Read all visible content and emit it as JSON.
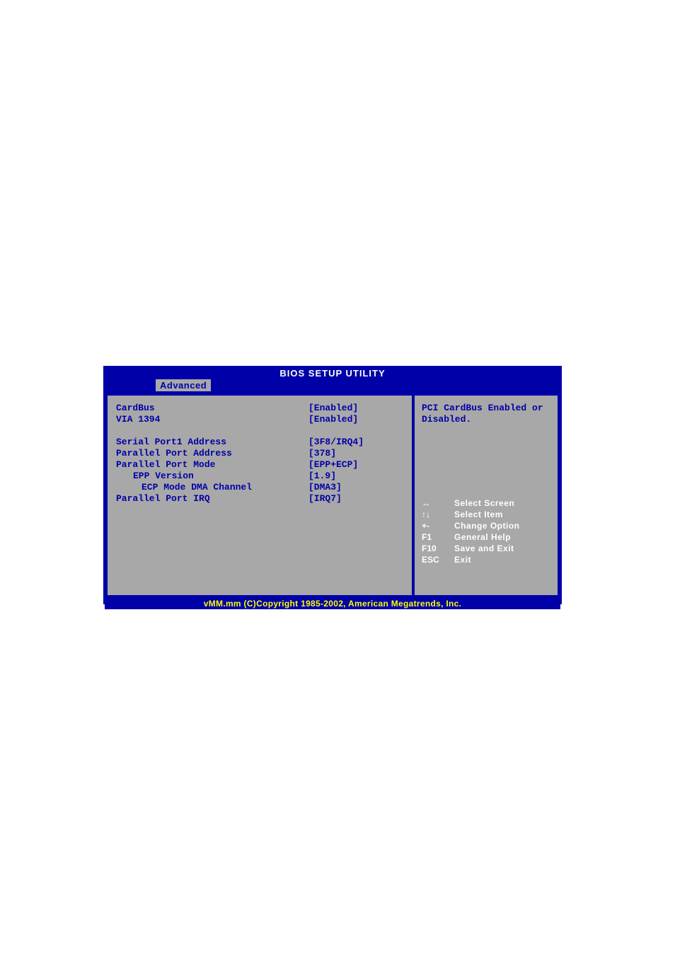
{
  "title": "BIOS SETUP UTILITY",
  "active_tab": "Advanced",
  "settings": [
    {
      "label": "CardBus",
      "value": "[Enabled]",
      "indent": 0
    },
    {
      "label": "VIA 1394",
      "value": "[Enabled]",
      "indent": 0
    }
  ],
  "settings_group2": [
    {
      "label": "Serial Port1 Address",
      "value": "[3F8/IRQ4]",
      "indent": 0
    },
    {
      "label": "Parallel Port Address",
      "value": "[378]",
      "indent": 0
    },
    {
      "label": "Parallel Port Mode",
      "value": "[EPP+ECP]",
      "indent": 0
    },
    {
      "label": "EPP Version",
      "value": "[1.9]",
      "indent": 1
    },
    {
      "label": "ECP Mode DMA Channel",
      "value": "[DMA3]",
      "indent": 2
    },
    {
      "label": "Parallel Port IRQ",
      "value": "[IRQ7]",
      "indent": 0
    }
  ],
  "help": {
    "line1": "PCI CardBus Enabled or",
    "line2": "Disabled."
  },
  "nav": [
    {
      "key": "↔",
      "action": "Select Screen"
    },
    {
      "key": "↑↓",
      "action": "Select Item"
    },
    {
      "key": "+-",
      "action": "Change Option"
    },
    {
      "key": "F1",
      "action": "General Help"
    },
    {
      "key": "F10",
      "action": "Save and Exit"
    },
    {
      "key": "ESC",
      "action": "Exit"
    }
  ],
  "footer": "vMM.mm (C)Copyright 1985-2002, American Megatrends, Inc."
}
